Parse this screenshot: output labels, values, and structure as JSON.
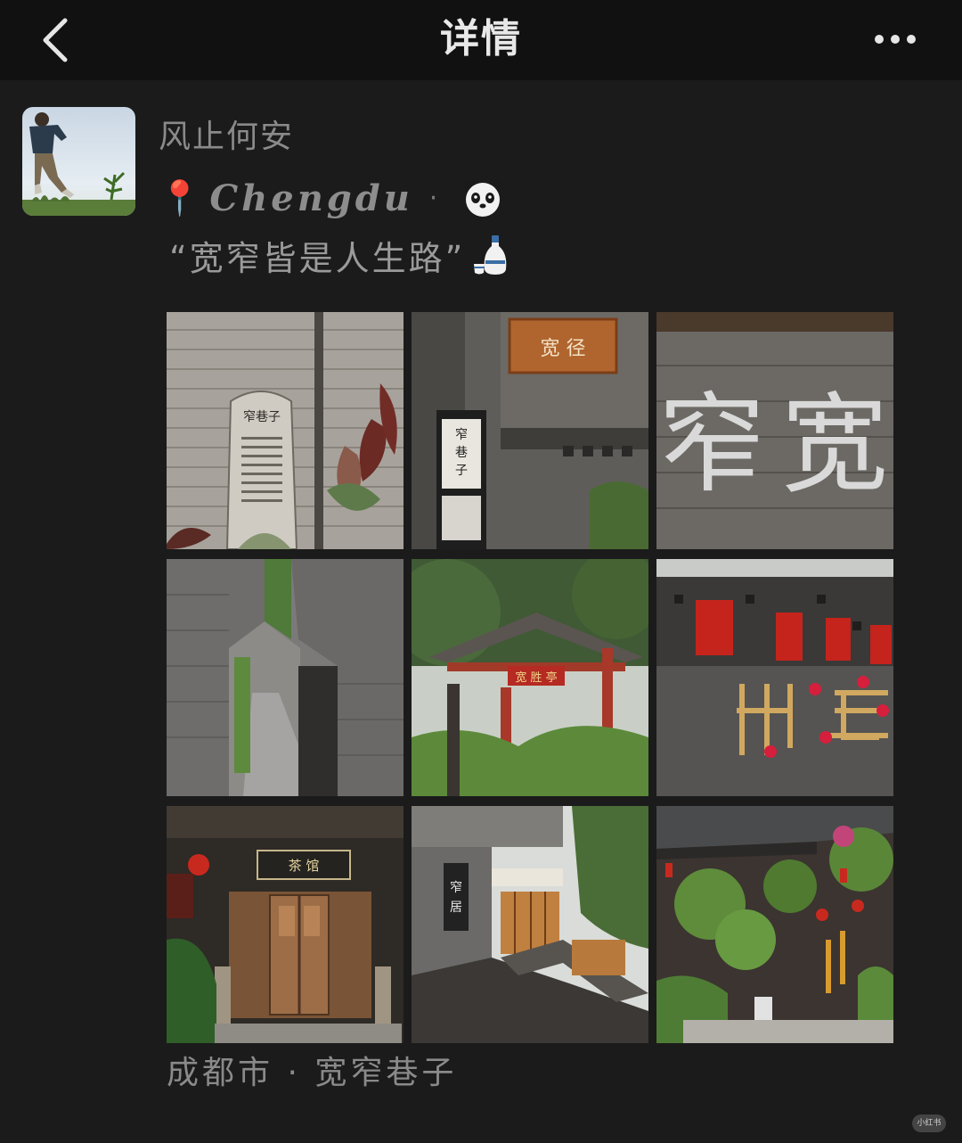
{
  "nav": {
    "title": "详情",
    "back_icon": "chevron-left-icon",
    "more_icon": "more-dots-icon"
  },
  "post": {
    "author": "风止何安",
    "location_tag": "Chengdu",
    "location_separator": "·",
    "pin_emoji": "📍",
    "panda_emoji": "🐼",
    "quote": "“宽窄皆是人生路”",
    "quote_emoji": "🍶",
    "photos": [
      {
        "id": "photo-1",
        "subject": "窄巷子 stone stele and brick wall"
      },
      {
        "id": "photo-2",
        "subject": "宽巷子 signboard and gate"
      },
      {
        "id": "photo-3",
        "subject": "宽 窄 characters on wall"
      },
      {
        "id": "photo-4",
        "subject": "narrow brick alley"
      },
      {
        "id": "photo-5",
        "subject": "red pavilion with trees"
      },
      {
        "id": "photo-6",
        "subject": "wall with red plaques"
      },
      {
        "id": "photo-7",
        "subject": "old wooden doorway"
      },
      {
        "id": "photo-8",
        "subject": "窄居 building facade"
      },
      {
        "id": "photo-9",
        "subject": "courtyard with plants and lanterns"
      }
    ],
    "photo_text": {
      "stele_title": "窄巷子",
      "sign_kuanxiang": "宽 径",
      "vertical_sign": "窄巷子",
      "wall_char_left": "窄",
      "wall_char_right": "宽",
      "pavilion_sign": "宽 胜 亭",
      "door_sign": "茶 馆",
      "zhaiju": "窄居"
    },
    "footer_location": "成都市 · 宽窄巷子"
  },
  "watermark": "小红书",
  "colors": {
    "background": "#1b1b1b",
    "navbar": "#111111",
    "text_primary": "#e8e8e8",
    "text_secondary": "#8a8a8a"
  }
}
